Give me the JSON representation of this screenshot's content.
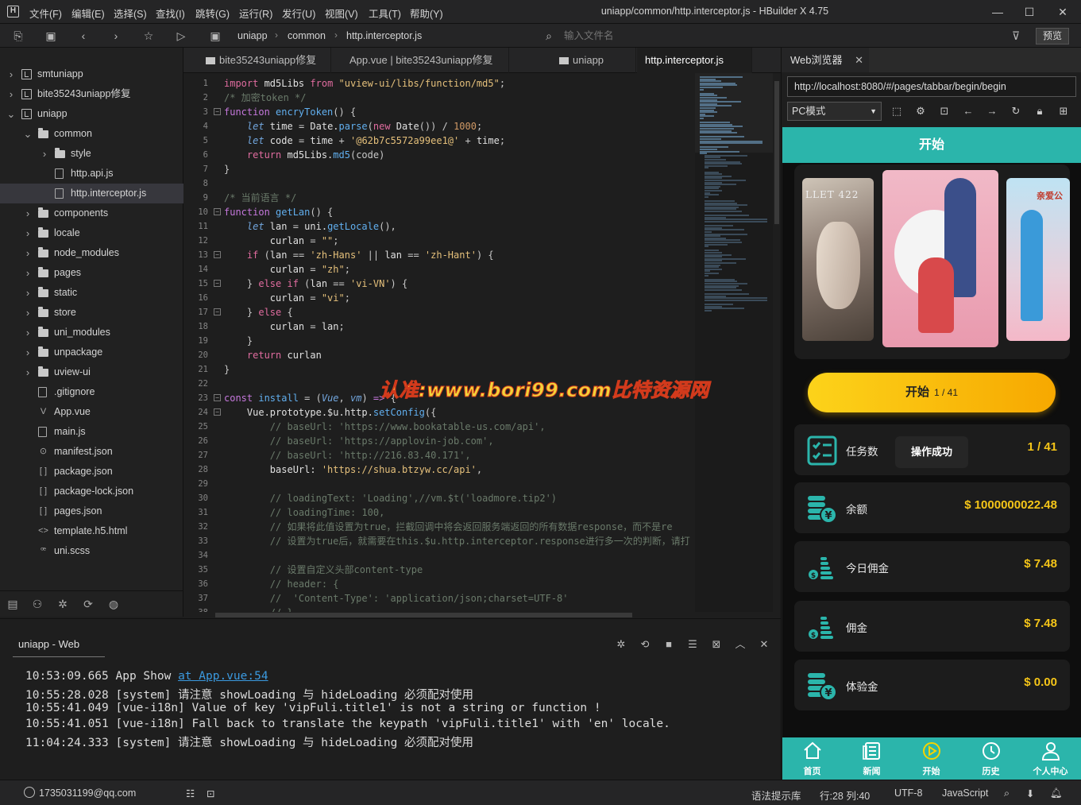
{
  "app": {
    "title": "uniapp/common/http.interceptor.js - HBuilder X 4.75",
    "menu": [
      "文件(F)",
      "编辑(E)",
      "选择(S)",
      "查找(I)",
      "跳转(G)",
      "运行(R)",
      "发行(U)",
      "视图(V)",
      "工具(T)",
      "帮助(Y)"
    ]
  },
  "toolbar": {
    "breadcrumb": [
      "uniapp",
      "common",
      "http.interceptor.js"
    ],
    "search_placeholder": "输入文件名",
    "preview_label": "预览"
  },
  "sidebar": {
    "items": [
      {
        "label": "smtuniapp",
        "level": 0,
        "type": "project",
        "arrow": "›"
      },
      {
        "label": "bite35243uniapp修复",
        "level": 0,
        "type": "project",
        "arrow": "›"
      },
      {
        "label": "uniapp",
        "level": 0,
        "type": "project",
        "arrow": "⌄"
      },
      {
        "label": "common",
        "level": 1,
        "type": "folder",
        "arrow": "⌄"
      },
      {
        "label": "style",
        "level": 2,
        "type": "folder",
        "arrow": "›"
      },
      {
        "label": "http.api.js",
        "level": 2,
        "type": "file",
        "arrow": ""
      },
      {
        "label": "http.interceptor.js",
        "level": 2,
        "type": "file",
        "arrow": "",
        "selected": true
      },
      {
        "label": "components",
        "level": 1,
        "type": "folder",
        "arrow": "›"
      },
      {
        "label": "locale",
        "level": 1,
        "type": "folder",
        "arrow": "›"
      },
      {
        "label": "node_modules",
        "level": 1,
        "type": "folder",
        "arrow": "›"
      },
      {
        "label": "pages",
        "level": 1,
        "type": "folder",
        "arrow": "›"
      },
      {
        "label": "static",
        "level": 1,
        "type": "folder",
        "arrow": "›"
      },
      {
        "label": "store",
        "level": 1,
        "type": "folder",
        "arrow": "›"
      },
      {
        "label": "uni_modules",
        "level": 1,
        "type": "folder",
        "arrow": "›"
      },
      {
        "label": "unpackage",
        "level": 1,
        "type": "folder",
        "arrow": "›"
      },
      {
        "label": "uview-ui",
        "level": 1,
        "type": "folder",
        "arrow": "›"
      },
      {
        "label": ".gitignore",
        "level": 1,
        "type": "file",
        "arrow": ""
      },
      {
        "label": "App.vue",
        "level": 1,
        "type": "glyph",
        "glyph": "V",
        "arrow": ""
      },
      {
        "label": "main.js",
        "level": 1,
        "type": "file",
        "arrow": ""
      },
      {
        "label": "manifest.json",
        "level": 1,
        "type": "glyph",
        "glyph": "⊙",
        "arrow": ""
      },
      {
        "label": "package.json",
        "level": 1,
        "type": "glyph",
        "glyph": "[ ]",
        "arrow": ""
      },
      {
        "label": "package-lock.json",
        "level": 1,
        "type": "glyph",
        "glyph": "[ ]",
        "arrow": ""
      },
      {
        "label": "pages.json",
        "level": 1,
        "type": "glyph",
        "glyph": "[ ]",
        "arrow": ""
      },
      {
        "label": "template.h5.html",
        "level": 1,
        "type": "glyph",
        "glyph": "<>",
        "arrow": ""
      },
      {
        "label": "uni.scss",
        "level": 1,
        "type": "glyph",
        "glyph": "ꟹ",
        "arrow": ""
      }
    ]
  },
  "editor": {
    "tabs": [
      {
        "label": "bite35243uniapp修复",
        "folder": true
      },
      {
        "label": "App.vue | bite35243uniapp修复",
        "folder": false
      },
      {
        "label": "uniapp",
        "folder": true
      },
      {
        "label": "http.interceptor.js",
        "folder": false,
        "active": true
      }
    ],
    "lines": [
      [
        [
          "kw",
          "import"
        ],
        [
          "id",
          " md5Libs "
        ],
        [
          "kw",
          "from"
        ],
        [
          "st",
          " \"uview-ui/libs/function/md5\""
        ],
        [
          "op",
          ";"
        ]
      ],
      [
        [
          "cm",
          "/* 加密token */"
        ]
      ],
      [
        [
          "kw2",
          "function"
        ],
        [
          "fn",
          " encryToken"
        ],
        [
          "br",
          "() {"
        ]
      ],
      [
        [
          "it",
          "    let"
        ],
        [
          "id",
          " time "
        ],
        [
          "op",
          "="
        ],
        [
          "id",
          " Date."
        ],
        [
          "fn",
          "parse"
        ],
        [
          "br",
          "("
        ],
        [
          "kw",
          "new"
        ],
        [
          "id",
          " Date"
        ],
        [
          "br",
          "())"
        ],
        [
          "op",
          " / "
        ],
        [
          "nu",
          "1000"
        ],
        [
          "op",
          ";"
        ]
      ],
      [
        [
          "it",
          "    let"
        ],
        [
          "id",
          " code "
        ],
        [
          "op",
          "="
        ],
        [
          "id",
          " time "
        ],
        [
          "op",
          "+"
        ],
        [
          "st",
          " '@62b7c5572a99ee1@'"
        ],
        [
          "op",
          " +"
        ],
        [
          "id",
          " time"
        ],
        [
          "op",
          ";"
        ]
      ],
      [
        [
          "kw",
          "    return"
        ],
        [
          "id",
          " md5Libs."
        ],
        [
          "fn",
          "md5"
        ],
        [
          "br",
          "(code)"
        ]
      ],
      [
        [
          "br",
          "}"
        ]
      ],
      [
        [
          "id",
          ""
        ]
      ],
      [
        [
          "cm",
          "/* 当前语言 */"
        ]
      ],
      [
        [
          "kw2",
          "function"
        ],
        [
          "fn",
          " getLan"
        ],
        [
          "br",
          "() {"
        ]
      ],
      [
        [
          "it",
          "    let"
        ],
        [
          "id",
          " lan "
        ],
        [
          "op",
          "="
        ],
        [
          "id",
          " uni."
        ],
        [
          "fn",
          "getLocale"
        ],
        [
          "br",
          "(),"
        ]
      ],
      [
        [
          "id",
          "        curlan "
        ],
        [
          "op",
          "="
        ],
        [
          "st",
          " \"\""
        ],
        [
          "op",
          ";"
        ]
      ],
      [
        [
          "kw",
          "    if"
        ],
        [
          "br",
          " ("
        ],
        [
          "id",
          "lan "
        ],
        [
          "op",
          "=="
        ],
        [
          "st",
          " 'zh-Hans'"
        ],
        [
          "op",
          " ||"
        ],
        [
          "id",
          " lan "
        ],
        [
          "op",
          "=="
        ],
        [
          "st",
          " 'zh-Hant'"
        ],
        [
          "br",
          ") {"
        ]
      ],
      [
        [
          "id",
          "        curlan "
        ],
        [
          "op",
          "="
        ],
        [
          "st",
          " \"zh\""
        ],
        [
          "op",
          ";"
        ]
      ],
      [
        [
          "br",
          "    } "
        ],
        [
          "kw",
          "else if"
        ],
        [
          "br",
          " ("
        ],
        [
          "id",
          "lan "
        ],
        [
          "op",
          "=="
        ],
        [
          "st",
          " 'vi-VN'"
        ],
        [
          "br",
          ") {"
        ]
      ],
      [
        [
          "id",
          "        curlan "
        ],
        [
          "op",
          "="
        ],
        [
          "st",
          " \"vi\""
        ],
        [
          "op",
          ";"
        ]
      ],
      [
        [
          "br",
          "    } "
        ],
        [
          "kw",
          "else"
        ],
        [
          "br",
          " {"
        ]
      ],
      [
        [
          "id",
          "        curlan "
        ],
        [
          "op",
          "="
        ],
        [
          "id",
          " lan"
        ],
        [
          "op",
          ";"
        ]
      ],
      [
        [
          "br",
          "    }"
        ]
      ],
      [
        [
          "kw",
          "    return"
        ],
        [
          "id",
          " curlan"
        ]
      ],
      [
        [
          "br",
          "}"
        ]
      ],
      [
        [
          "id",
          ""
        ]
      ],
      [
        [
          "kw2",
          "const"
        ],
        [
          "fn",
          " install "
        ],
        [
          "op",
          "="
        ],
        [
          "br",
          " ("
        ],
        [
          "it",
          "Vue"
        ],
        [
          "op",
          ", "
        ],
        [
          "it",
          "vm"
        ],
        [
          "br",
          ") "
        ],
        [
          "kw2",
          "=>"
        ],
        [
          "br",
          " {"
        ]
      ],
      [
        [
          "id",
          "    Vue.prototype.$u.http."
        ],
        [
          "fn",
          "setConfig"
        ],
        [
          "br",
          "({"
        ]
      ],
      [
        [
          "cm",
          "        // baseUrl: 'https://www.bookatable-us.com/api',"
        ]
      ],
      [
        [
          "cm",
          "        // baseUrl: 'https://applovin-job.com',"
        ]
      ],
      [
        [
          "cm",
          "        // baseUrl: 'http://216.83.40.171',"
        ]
      ],
      [
        [
          "id",
          "        baseUrl: "
        ],
        [
          "st",
          "'https://shua.btzyw.cc/api'"
        ],
        [
          "op",
          ","
        ]
      ],
      [
        [
          "id",
          ""
        ]
      ],
      [
        [
          "cm",
          "        // loadingText: 'Loading',//vm.$t('loadmore.tip2')"
        ]
      ],
      [
        [
          "cm",
          "        // loadingTime: 100,"
        ]
      ],
      [
        [
          "cm",
          "        // 如果将此值设置为true，拦截回调中将会返回服务端返回的所有数据response，而不是re"
        ]
      ],
      [
        [
          "cm",
          "        // 设置为true后，就需要在this.$u.http.interceptor.response进行多一次的判断，请打"
        ]
      ],
      [
        [
          "id",
          ""
        ]
      ],
      [
        [
          "cm",
          "        // 设置自定义头部content-type"
        ]
      ],
      [
        [
          "cm",
          "        // header: {"
        ]
      ],
      [
        [
          "cm",
          "        //  'Content-Type': 'application/json;charset=UTF-8'"
        ]
      ],
      [
        [
          "cm",
          "        // }"
        ]
      ]
    ]
  },
  "watermark": "认准:www.bori99.com比特资源网",
  "console": {
    "tab_label": "uniapp - Web",
    "lines": [
      {
        "text": "10:53:09.665 App Show ",
        "link": "at App.vue:54"
      },
      {
        "text": "10:55:28.028 [system] 请注意 showLoading 与 hideLoading 必须配对使用",
        "link": ""
      },
      {
        "text": "10:55:41.049 [vue-i18n] Value of key 'vipFuli.title1' is not a string or function !",
        "link": ""
      },
      {
        "text": "10:55:41.051 [vue-i18n] Fall back to translate the keypath 'vipFuli.title1' with 'en' locale.",
        "link": ""
      },
      {
        "text": "11:04:24.333 [system] 请注意 showLoading 与 hideLoading 必须配对使用",
        "link": ""
      }
    ]
  },
  "statusbar": {
    "account": "1735031199@qq.com",
    "syntax_lib": "语法提示库",
    "position": "行:28  列:40",
    "encoding": "UTF-8",
    "language": "JavaScript"
  },
  "browser": {
    "tab_label": "Web浏览器",
    "url": "http://localhost:8080/#/pages/tabbar/begin/begin",
    "mode": "PC模式",
    "page": {
      "header_title": "开始",
      "start_button": "开始",
      "start_count": "1 / 41",
      "toast": "操作成功",
      "stats": [
        {
          "label": "任务数",
          "value": "1 / 41",
          "icon": "checklist-icon"
        },
        {
          "label": "余额",
          "value": "$ 1000000022.48",
          "icon": "coins-yen-icon"
        },
        {
          "label": "今日佣金",
          "value": "$ 7.48",
          "icon": "coins-dollar-icon"
        },
        {
          "label": "佣金",
          "value": "$ 7.48",
          "icon": "coins-dollar-icon"
        },
        {
          "label": "体验金",
          "value": "$ 0.00",
          "icon": "coins-yen-icon"
        }
      ],
      "tabbar": [
        "首页",
        "新闻",
        "开始",
        "历史",
        "个人中心"
      ],
      "poster_texts": [
        "LLET 422",
        "亲爱公"
      ]
    },
    "accent_color": "#2bb5ab",
    "value_color": "#f5c518"
  }
}
